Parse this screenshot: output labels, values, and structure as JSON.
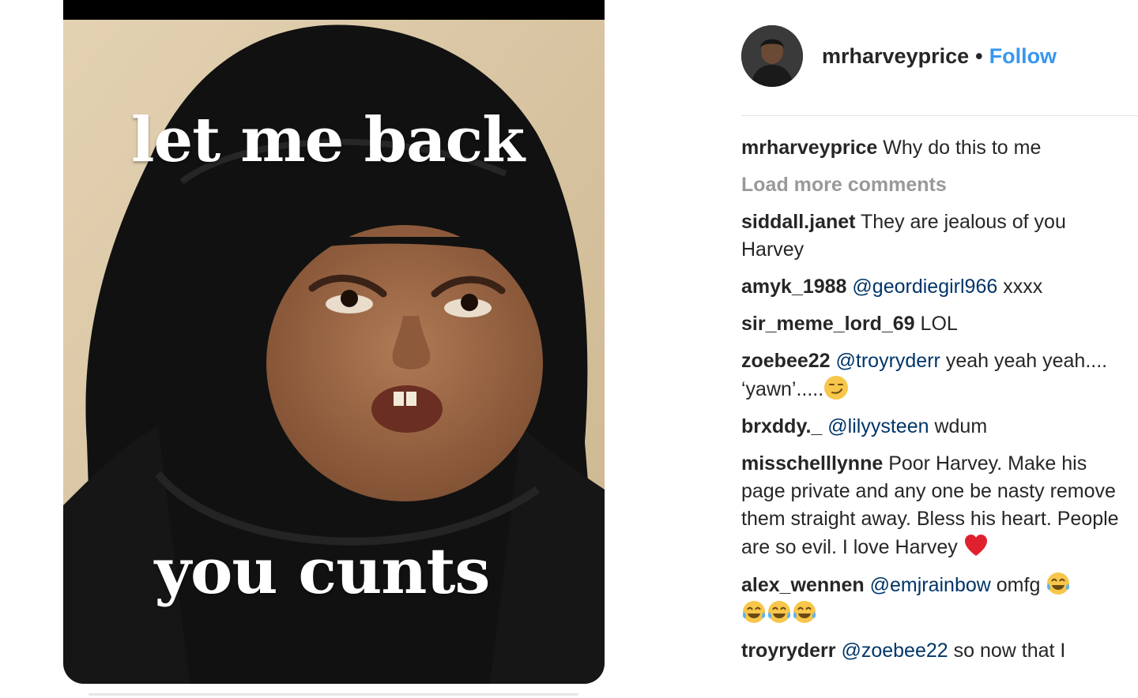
{
  "post": {
    "meme_top_text": "let me back",
    "meme_bottom_text": "you cunts"
  },
  "header": {
    "username": "mrharveyprice",
    "separator": "•",
    "follow_label": "Follow"
  },
  "caption": {
    "user": "mrharveyprice",
    "text": "Why do this to me"
  },
  "load_more_label": "Load more comments",
  "comments": [
    {
      "user": "siddall.janet",
      "text": "They are jealous of you Harvey"
    },
    {
      "user": "amyk_1988",
      "mention": "@geordiegirl966",
      "text": "xxxx"
    },
    {
      "user": "sir_meme_lord_69",
      "text": "LOL"
    },
    {
      "user": "zoebee22",
      "mention": "@troyryderr",
      "text": "yeah yeah yeah.... ‘yawn’.....",
      "emoji": "smirk-emoji"
    },
    {
      "user": "brxddy._",
      "mention": "@lilyysteen",
      "text": "wdum"
    },
    {
      "user": "misschelllynne",
      "text": "Poor Harvey. Make his page private and any one be nasty remove them straight away. Bless his heart. People are so evil. I love Harvey",
      "emoji": "red-heart-emoji"
    },
    {
      "user": "alex_wennen",
      "mention": "@emjrainbow",
      "text": "omfg",
      "emoji": "tears-of-joy-emoji"
    },
    {
      "user": "troyryderr",
      "mention": "@zoebee22",
      "text": "so now that I"
    }
  ],
  "colors": {
    "follow": "#3897f0",
    "mention": "#003569",
    "muted": "#999999"
  }
}
